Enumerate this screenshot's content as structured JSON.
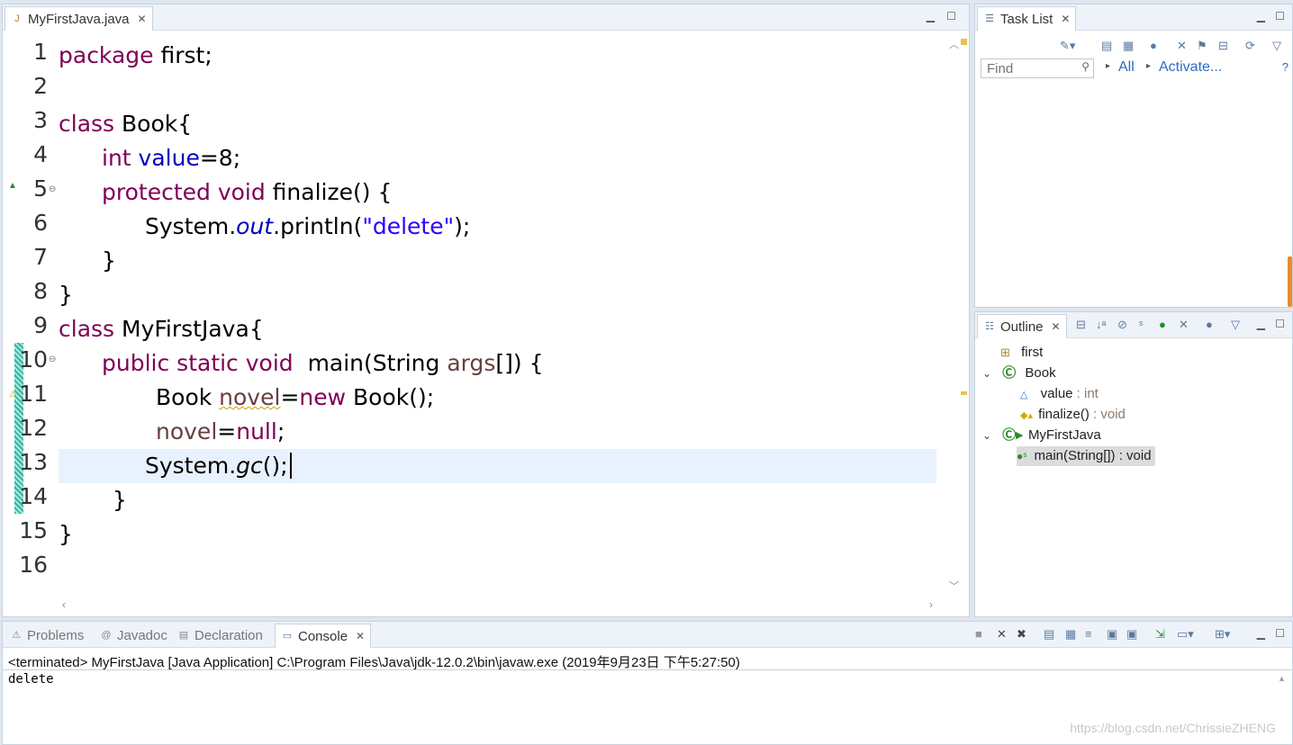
{
  "editor": {
    "tab_label": "MyFirstJava.java",
    "lines": [
      {
        "num": "1"
      },
      {
        "num": "2"
      },
      {
        "num": "3"
      },
      {
        "num": "4"
      },
      {
        "num": "5"
      },
      {
        "num": "6"
      },
      {
        "num": "7"
      },
      {
        "num": "8"
      },
      {
        "num": "9"
      },
      {
        "num": "10"
      },
      {
        "num": "11"
      },
      {
        "num": "12"
      },
      {
        "num": "13"
      },
      {
        "num": "14"
      },
      {
        "num": "15"
      },
      {
        "num": "16"
      }
    ],
    "code": {
      "l1_kw": "package",
      "l1_rest": " first;",
      "l3_kw": "class",
      "l3_rest": " Book{",
      "l4_kw": "int",
      "l4_fld": "value",
      "l4_rest": "=8;",
      "l5_kw1": "protected",
      "l5_kw2": "void",
      "l5_rest": " finalize() {",
      "l6_a": "System.",
      "l6_out": "out",
      "l6_b": ".println(",
      "l6_str": "\"delete\"",
      "l6_c": ");",
      "l7": "}",
      "l8": "}",
      "l9_kw": "class",
      "l9_rest": " MyFirstJava{",
      "l10_kw": "public static void",
      "l10_a": "  main(String ",
      "l10_arg": "args",
      "l10_b": "[]) {",
      "l11_a": "Book ",
      "l11_var": "novel",
      "l11_b": "=",
      "l11_kw": "new",
      "l11_c": " Book();",
      "l12_var": "novel",
      "l12_a": "=",
      "l12_kw": "null",
      "l12_b": ";",
      "l13_a": "System.",
      "l13_gc": "gc",
      "l13_b": "();",
      "l14": "}",
      "l15": "}"
    }
  },
  "task_list": {
    "tab_label": "Task List",
    "find_placeholder": "Find",
    "all_label": "All",
    "activate_label": "Activate..."
  },
  "outline": {
    "tab_label": "Outline",
    "items": {
      "pkg": "first",
      "book": "Book",
      "value": "value",
      "value_type": " : int",
      "finalize": "finalize()",
      "finalize_type": " : void",
      "myfirst": "MyFirstJava",
      "main": "main(String[]) : void"
    }
  },
  "console": {
    "tabs": [
      "Problems",
      "Javadoc",
      "Declaration",
      "Console"
    ],
    "header": "<terminated> MyFirstJava [Java Application] C:\\Program Files\\Java\\jdk-12.0.2\\bin\\javaw.exe (2019年9月23日 下午5:27:50)",
    "output": "delete",
    "watermark": "https://blog.csdn.net/ChrissieZHENG"
  }
}
